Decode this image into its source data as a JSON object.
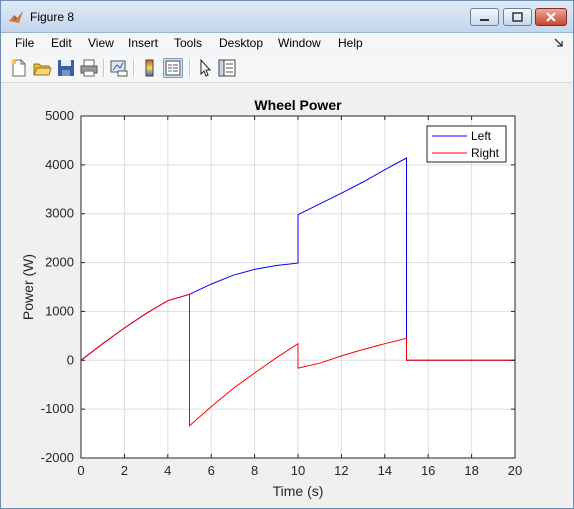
{
  "window": {
    "title": "Figure 8"
  },
  "menu": [
    "File",
    "Edit",
    "View",
    "Insert",
    "Tools",
    "Desktop",
    "Window",
    "Help"
  ],
  "toolbar": [
    "new-figure",
    "open-file",
    "save",
    "print",
    "link-plot",
    "insert-colorbar",
    "insert-legend",
    "edit-plot",
    "property-inspector"
  ],
  "chart_data": {
    "type": "line",
    "title": "Wheel Power",
    "xlabel": "Time (s)",
    "ylabel": "Power (W)",
    "xlim": [
      0,
      20
    ],
    "ylim": [
      -2000,
      5000
    ],
    "xticks": [
      0,
      2,
      4,
      6,
      8,
      10,
      12,
      14,
      16,
      18,
      20
    ],
    "yticks": [
      -2000,
      -1000,
      0,
      1000,
      2000,
      3000,
      4000,
      5000
    ],
    "grid": true,
    "legend": {
      "position": "top-right",
      "entries": [
        "Left",
        "Right"
      ]
    },
    "series": [
      {
        "name": "Left",
        "color": "#0000ff",
        "points": [
          [
            0,
            0
          ],
          [
            1,
            340
          ],
          [
            2,
            660
          ],
          [
            3,
            960
          ],
          [
            4,
            1220
          ],
          [
            5,
            1350
          ],
          [
            6,
            1560
          ],
          [
            7,
            1740
          ],
          [
            8,
            1860
          ],
          [
            9,
            1940
          ],
          [
            10,
            1990
          ],
          [
            10,
            2980
          ],
          [
            11,
            3200
          ],
          [
            12,
            3420
          ],
          [
            13,
            3650
          ],
          [
            14,
            3900
          ],
          [
            15,
            4140
          ],
          [
            15,
            0
          ],
          [
            16,
            0
          ],
          [
            18,
            0
          ],
          [
            20,
            0
          ]
        ]
      },
      {
        "name": "Right",
        "color": "#ff0000",
        "points": [
          [
            0,
            0
          ],
          [
            1,
            340
          ],
          [
            2,
            660
          ],
          [
            3,
            960
          ],
          [
            4,
            1220
          ],
          [
            5,
            1350
          ],
          [
            5,
            -1340
          ],
          [
            6,
            -950
          ],
          [
            7,
            -580
          ],
          [
            8,
            -260
          ],
          [
            9,
            50
          ],
          [
            10,
            340
          ],
          [
            10,
            -160
          ],
          [
            11,
            -60
          ],
          [
            12,
            90
          ],
          [
            13,
            220
          ],
          [
            14,
            340
          ],
          [
            15,
            450
          ],
          [
            15,
            0
          ],
          [
            16,
            0
          ],
          [
            18,
            0
          ],
          [
            20,
            0
          ]
        ]
      }
    ]
  }
}
